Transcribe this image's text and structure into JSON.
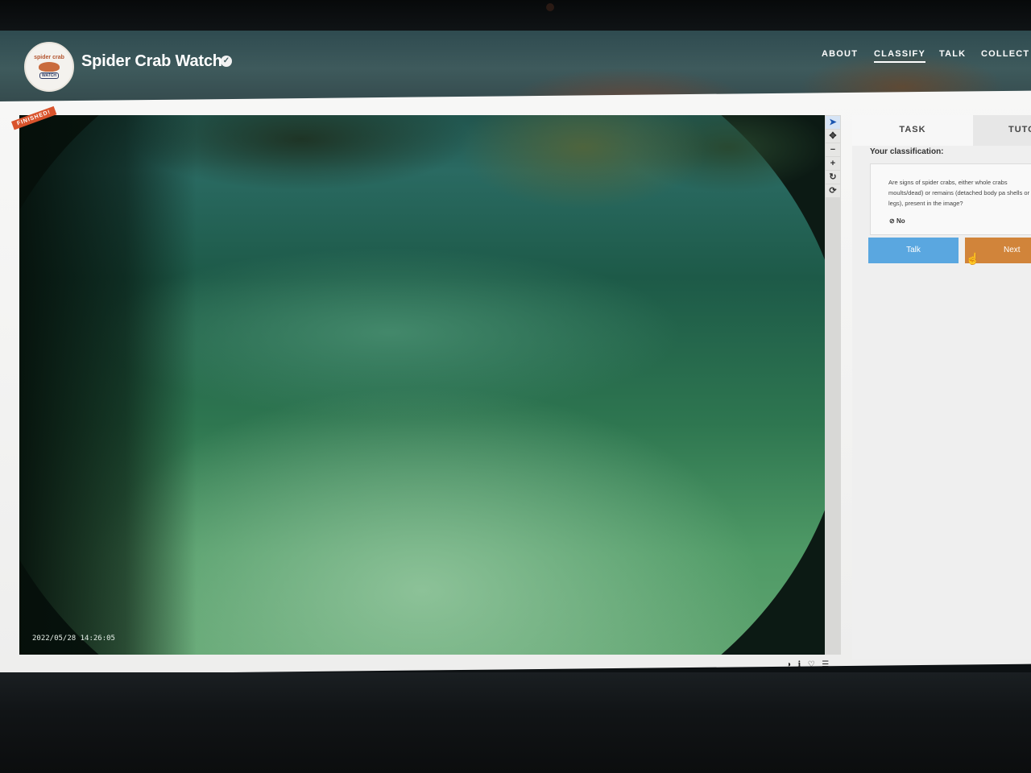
{
  "header": {
    "site_title": "Spider Crab Watch",
    "logo_text": "spider crab",
    "logo_sub": "WATCH"
  },
  "nav": {
    "items": [
      {
        "label": "ABOUT"
      },
      {
        "label": "CLASSIFY",
        "active": true
      },
      {
        "label": "TALK"
      },
      {
        "label": "COLLECT"
      }
    ]
  },
  "subject": {
    "status_ribbon": "FINISHED!",
    "timestamp": "2022/05/28 14:26:05"
  },
  "toolbar": {
    "tools": [
      {
        "icon": "pointer-icon",
        "glyph": "➤"
      },
      {
        "icon": "move-icon",
        "glyph": "✥"
      },
      {
        "icon": "zoom-out-icon",
        "glyph": "−"
      },
      {
        "icon": "zoom-in-icon",
        "glyph": "+"
      },
      {
        "icon": "rotate-icon",
        "glyph": "↻"
      },
      {
        "icon": "reset-icon",
        "glyph": "⟳"
      }
    ]
  },
  "meta_icons": [
    "◑",
    "ℹ",
    "♡",
    "☰"
  ],
  "panel": {
    "tabs": [
      {
        "label": "TASK",
        "active": true
      },
      {
        "label": "TUTO"
      }
    ],
    "classification_label": "Your classification:",
    "question": "Are signs of spider crabs, either whole crabs moults/dead) or remains (detached body pa shells or legs), present in the image?",
    "answer_icon": "⊘",
    "answer": "No",
    "talk_button": "Talk",
    "next_button": "Next"
  },
  "colors": {
    "talk": "#5aa7e0",
    "next": "#d1843a",
    "ribbon": "#d9532c"
  }
}
